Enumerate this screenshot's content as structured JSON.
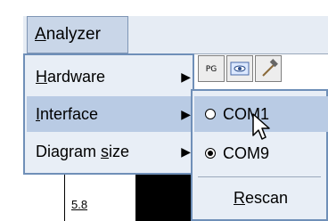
{
  "menubar": {
    "analyzer_label": "Analyzer",
    "analyzer_mnemonic": "A",
    "analyzer_rest": "nalyzer"
  },
  "dropdown": {
    "items": [
      {
        "mnemonic": "H",
        "rest": "ardware",
        "label": "Hardware",
        "has_submenu": true
      },
      {
        "mnemonic": "I",
        "rest": "nterface",
        "label": "Interface",
        "has_submenu": true,
        "active": true
      },
      {
        "pre": "Diagram ",
        "mnemonic": "s",
        "rest": "ize",
        "label": "Diagram size",
        "has_submenu": true
      }
    ]
  },
  "submenu": {
    "items": [
      {
        "label": "COM1",
        "type": "radio",
        "selected": false,
        "active": true
      },
      {
        "label": "COM9",
        "type": "radio",
        "selected": true
      },
      {
        "mnemonic": "R",
        "rest": "escan",
        "label": "Rescan",
        "type": "action"
      }
    ]
  },
  "toolbar": {
    "jpg_label": "PG"
  },
  "chart": {
    "value_label": "5.8"
  },
  "icons": {
    "submenu_arrow": "triangle-right-icon",
    "cursor": "pointer-cursor-icon"
  },
  "colors": {
    "menu_bg": "#e8eef6",
    "menu_active": "#b9cbe4",
    "menu_border": "#6f8fb8"
  }
}
